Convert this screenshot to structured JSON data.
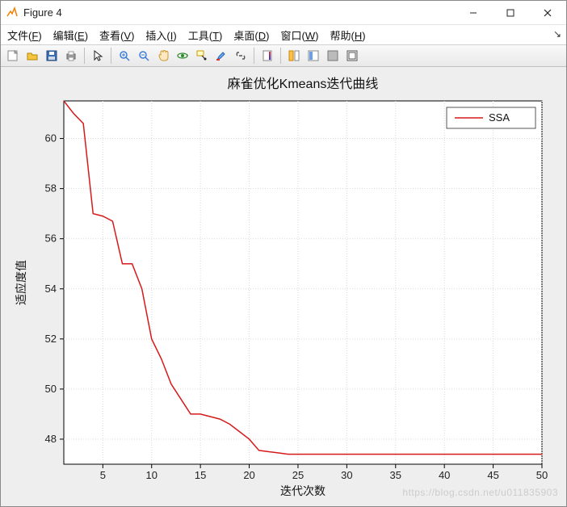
{
  "window": {
    "title": "Figure 4"
  },
  "menu": {
    "file": {
      "label": "文件",
      "accel": "F"
    },
    "edit": {
      "label": "编辑",
      "accel": "E"
    },
    "view": {
      "label": "查看",
      "accel": "V"
    },
    "insert": {
      "label": "插入",
      "accel": "I"
    },
    "tools": {
      "label": "工具",
      "accel": "T"
    },
    "desktop": {
      "label": "桌面",
      "accel": "D"
    },
    "window": {
      "label": "窗口",
      "accel": "W"
    },
    "help": {
      "label": "帮助",
      "accel": "H"
    }
  },
  "toolbar": {
    "icons": [
      "new-figure",
      "open",
      "save",
      "print",
      "",
      "pointer",
      "",
      "zoom-in",
      "zoom-out",
      "pan",
      "rotate3d",
      "data-cursor",
      "brush",
      "link-plot",
      "",
      "insert-colorbar",
      "",
      "tile",
      "float",
      "dock",
      "maximize"
    ]
  },
  "chart_data": {
    "type": "line",
    "title": "麻雀优化Kmeans迭代曲线",
    "xlabel": "迭代次数",
    "ylabel": "适应度值",
    "xlim": [
      1,
      50
    ],
    "ylim": [
      47,
      61.5
    ],
    "xticks": [
      5,
      10,
      15,
      20,
      25,
      30,
      35,
      40,
      45,
      50
    ],
    "yticks": [
      48,
      50,
      52,
      54,
      56,
      58,
      60
    ],
    "series": [
      {
        "name": "SSA",
        "color": "#d61a1a",
        "x": [
          1,
          2,
          3,
          4,
          5,
          6,
          7,
          8,
          9,
          10,
          11,
          12,
          13,
          14,
          15,
          16,
          17,
          18,
          19,
          20,
          21,
          22,
          23,
          24,
          25,
          30,
          35,
          40,
          45,
          50
        ],
        "y": [
          61.5,
          61.0,
          60.6,
          57.0,
          56.9,
          56.7,
          55.0,
          55.0,
          54.0,
          52.0,
          51.2,
          50.2,
          49.6,
          49.0,
          49.0,
          48.9,
          48.8,
          48.6,
          48.3,
          48.0,
          47.55,
          47.5,
          47.45,
          47.4,
          47.4,
          47.4,
          47.4,
          47.4,
          47.4,
          47.4
        ]
      }
    ],
    "legend": {
      "position": "northeast"
    }
  },
  "watermark": "https://blog.csdn.net/u011835903"
}
